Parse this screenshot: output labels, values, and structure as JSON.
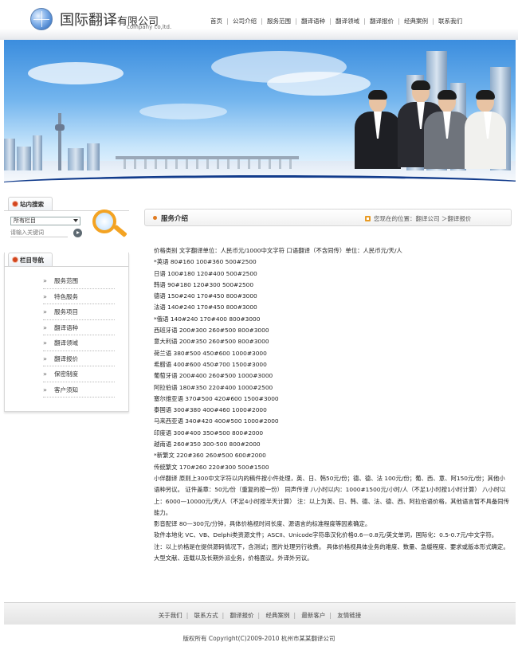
{
  "brand": {
    "name": "国际翻译",
    "suffix": "有限公司",
    "sub": "company co,ltd."
  },
  "nav": [
    "首页",
    "公司介绍",
    "服务范围",
    "翻译语种",
    "翻译领域",
    "翻译报价",
    "经典案例",
    "联系我们"
  ],
  "search": {
    "title": "站内搜索",
    "select_value": "所有栏目",
    "placeholder": "请输入关键词"
  },
  "sidebar": {
    "title": "栏目导航",
    "items": [
      "服务范围",
      "特色服务",
      "服务项目",
      "翻译语种",
      "翻译领域",
      "翻译报价",
      "保密制度",
      "客户须知"
    ]
  },
  "main": {
    "title": "服务介绍",
    "breadcrumb": "您现在的位置：翻译公司 ＞翻译报价"
  },
  "content": {
    "lines": [
      "价格类别  文字翻译单位：人民币元/1000中文字符  口语翻译（不含同传）单位：人民币元/天/人",
      "*英语  80#160 100#360 500#2500",
      "日语  100#180 120#400 500#2500",
      "韩语  90#180 120#300 500#2500",
      "德语  150#240 170#450 800#3000",
      "法语  140#240 170#450 800#3000",
      "*俄语  140#240 170#400 800#3000",
      "西班牙语  200#300 260#500 800#3000",
      "意大利语  200#350 260#500 800#3000",
      "荷兰语  380#500 450#600 1000#3000",
      "希腊语  400#600 450#700 1500#3000",
      "葡萄牙语  200#400 260#500 1000#3000",
      "阿拉伯语  180#350 220#400 1000#2500",
      "塞尔维亚语  370#500 420#600 1500#3000",
      "泰国语  300#380 400#460 1000#2000",
      "马来西亚语  340#420 400#500 1000#2000",
      "印度语  300#400 350#500 800#2000",
      "越南语  260#350 300-500 800#2000",
      "*新繁文  220#360 260#500 600#2000",
      "传统繁文  170#260 220#300 500#1500"
    ],
    "paragraphs": [
      "小伴翻译  原则上300中文字符以内的稿件按小件处理，英、日、韩50元/份；德、德、法 100元/份；葡、西、意、阿150元/份；其他小语种另议。  证件盖章：50元/份（重复的按一份）  同声传译  八小时以内：1000#1500元/小时/人（不足1小时按1小时计算）  八小时以上：6000—10000元/天/人（不足4小时按半天计算）  注：以上为英、日、韩、德、法、德、西、阿拉伯语价格，其他语言暂不具备同传能力。",
      "影音配译  80—300元/分钟，具体价格视时间长度、源语言的标准程度等因素确定。",
      "软件本地化  VC、VB、Delphi类资源文件；ASCII、Unicode字符串汉化价格0.6—0.8元/英文单词，国际化：0.5-0.7元/中文字符。",
      "注：以上价格是在提供源码情况下，含测试；图片处理另行收费。 具体价格视具体业务的难度、数量、急缓程度、要求或版本形式确定。大型文献、连载以及长期外派业务，价格面议。外译外另议。"
    ]
  },
  "footer": {
    "links": [
      "关于我们",
      "联系方式",
      "翻译报价",
      "经典案例",
      "最新客户",
      "友情链接"
    ],
    "copyright": "版权所有  Copyright(C)2009-2010 杭州市某某翻译公司"
  }
}
